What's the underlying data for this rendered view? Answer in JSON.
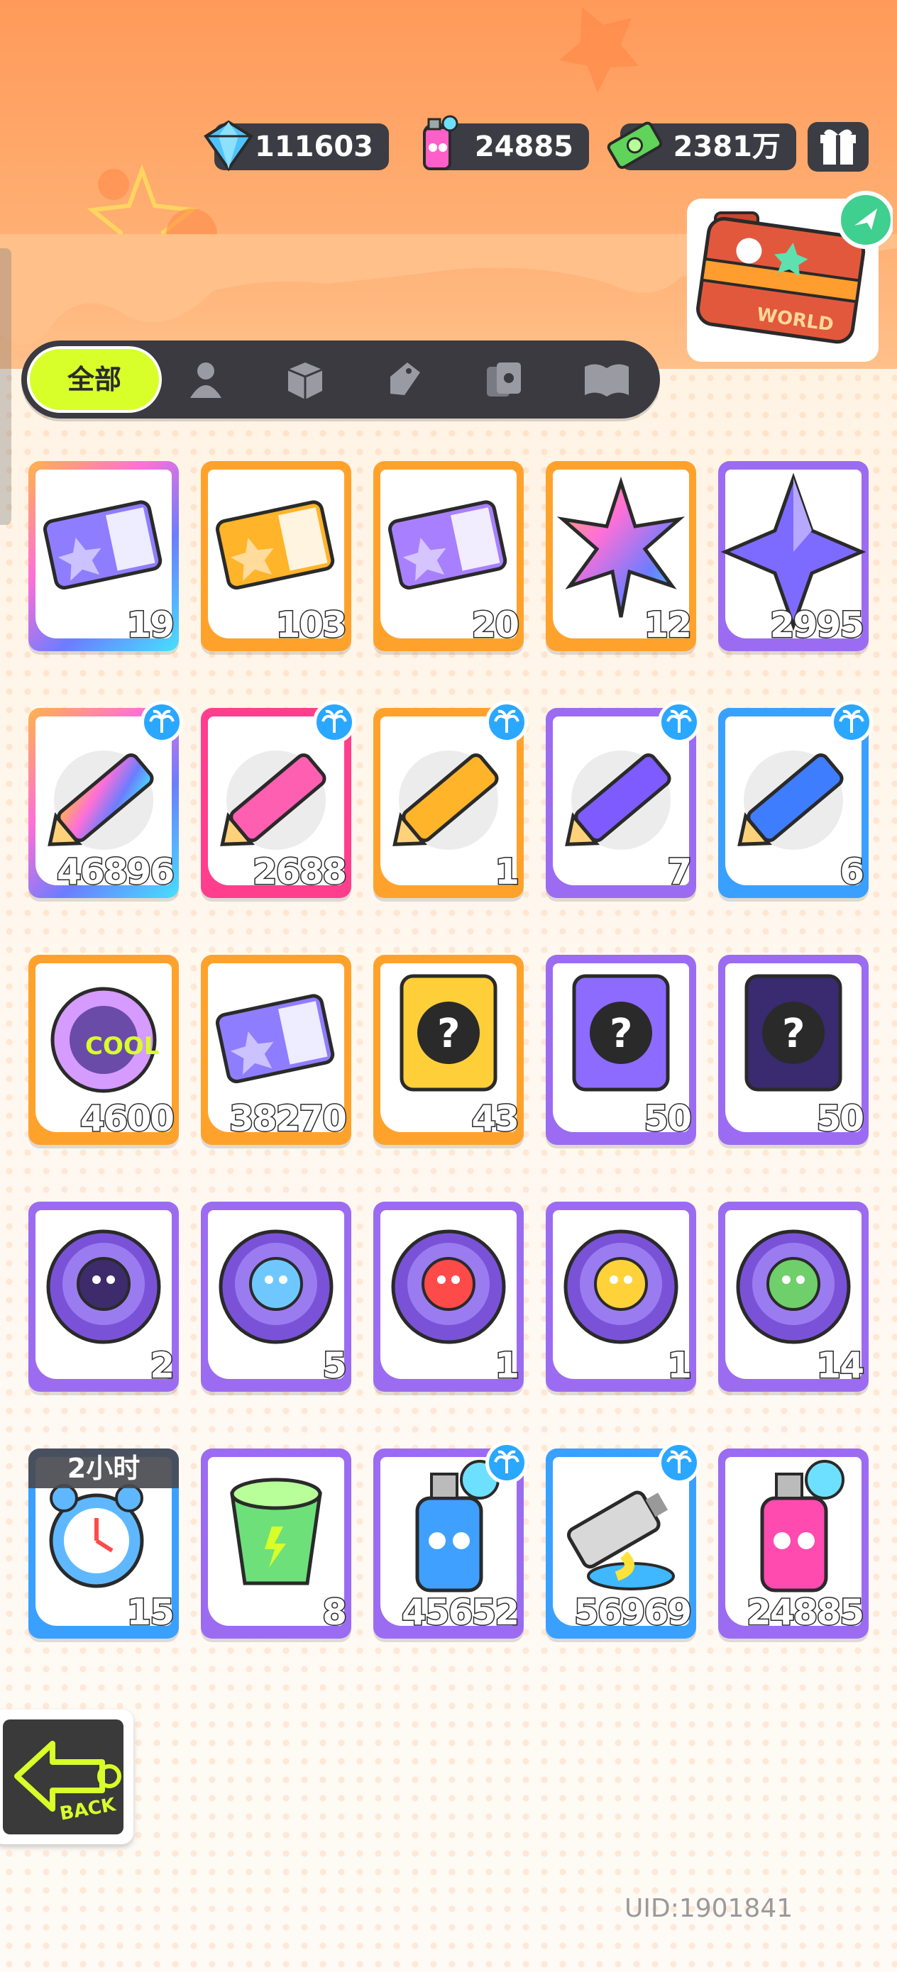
{
  "currencies": [
    {
      "name": "diamond-icon",
      "value": "111603"
    },
    {
      "name": "spray-can-icon",
      "value": "24885"
    },
    {
      "name": "cash-icon",
      "value": "2381万"
    }
  ],
  "tabs": {
    "all_label": "全部",
    "icons": [
      "person-icon",
      "box-icon",
      "tag-icon",
      "cards-icon",
      "book-icon"
    ]
  },
  "items": [
    {
      "row": 0,
      "col": 0,
      "icon": "deity-ticket-purple-icon",
      "qty": "19",
      "frame": "rainbow"
    },
    {
      "row": 0,
      "col": 1,
      "icon": "deity-ticket-gold-icon",
      "qty": "103",
      "frame": "orange"
    },
    {
      "row": 0,
      "col": 2,
      "icon": "deity-ticket-violet-icon",
      "qty": "20",
      "frame": "orange"
    },
    {
      "row": 0,
      "col": 3,
      "icon": "rainbow-star-icon",
      "qty": "12",
      "frame": "orange"
    },
    {
      "row": 0,
      "col": 4,
      "icon": "purple-star-icon",
      "qty": "2995",
      "frame": "purple"
    },
    {
      "row": 1,
      "col": 0,
      "icon": "rainbow-crayon-icon",
      "qty": "46896",
      "frame": "rainbow",
      "badge": true
    },
    {
      "row": 1,
      "col": 1,
      "icon": "pink-crayon-icon",
      "qty": "2688",
      "frame": "pink",
      "badge": true
    },
    {
      "row": 1,
      "col": 2,
      "icon": "orange-crayon-icon",
      "qty": "1",
      "frame": "orange",
      "badge": true
    },
    {
      "row": 1,
      "col": 3,
      "icon": "purple-crayon-icon",
      "qty": "7",
      "frame": "purple",
      "badge": true
    },
    {
      "row": 1,
      "col": 4,
      "icon": "blue-crayon-icon",
      "qty": "6",
      "frame": "blue",
      "badge": true
    },
    {
      "row": 2,
      "col": 0,
      "icon": "cool-badge-icon",
      "qty": "4600",
      "frame": "orange"
    },
    {
      "row": 2,
      "col": 1,
      "icon": "season-ticket-icon",
      "qty": "38270",
      "frame": "orange"
    },
    {
      "row": 2,
      "col": 2,
      "icon": "deity-mystery-gold-icon",
      "qty": "43",
      "frame": "orange"
    },
    {
      "row": 2,
      "col": 3,
      "icon": "deity-mystery-purple-icon",
      "qty": "50",
      "frame": "purple"
    },
    {
      "row": 2,
      "col": 4,
      "icon": "travel-card-mystery-icon",
      "qty": "50",
      "frame": "purple"
    },
    {
      "row": 3,
      "col": 0,
      "icon": "bat-pet-orb-icon",
      "qty": "2",
      "frame": "purple"
    },
    {
      "row": 3,
      "col": 1,
      "icon": "fish-pet-orb-icon",
      "qty": "5",
      "frame": "purple"
    },
    {
      "row": 3,
      "col": 2,
      "icon": "piranha-pet-orb-icon",
      "qty": "1",
      "frame": "purple"
    },
    {
      "row": 3,
      "col": 3,
      "icon": "jellyfish-pet-orb-icon",
      "qty": "1",
      "frame": "purple"
    },
    {
      "row": 3,
      "col": 4,
      "icon": "plant-pet-orb-icon",
      "qty": "14",
      "frame": "purple"
    },
    {
      "row": 4,
      "col": 0,
      "icon": "alarm-clock-icon",
      "qty": "15",
      "frame": "blue",
      "timer": "2小时"
    },
    {
      "row": 4,
      "col": 1,
      "icon": "green-cup-icon",
      "qty": "8",
      "frame": "purple"
    },
    {
      "row": 4,
      "col": 2,
      "icon": "blue-spray-can-icon",
      "qty": "45652",
      "frame": "purple",
      "badge": true
    },
    {
      "row": 4,
      "col": 3,
      "icon": "paint-tube-icon",
      "qty": "56969",
      "frame": "blue",
      "badge": true
    },
    {
      "row": 4,
      "col": 4,
      "icon": "pink-spray-can-icon",
      "qty": "24885",
      "frame": "purple"
    }
  ],
  "back_label": "BACK",
  "world_label": "WORLD",
  "uid": "UID:1901841"
}
